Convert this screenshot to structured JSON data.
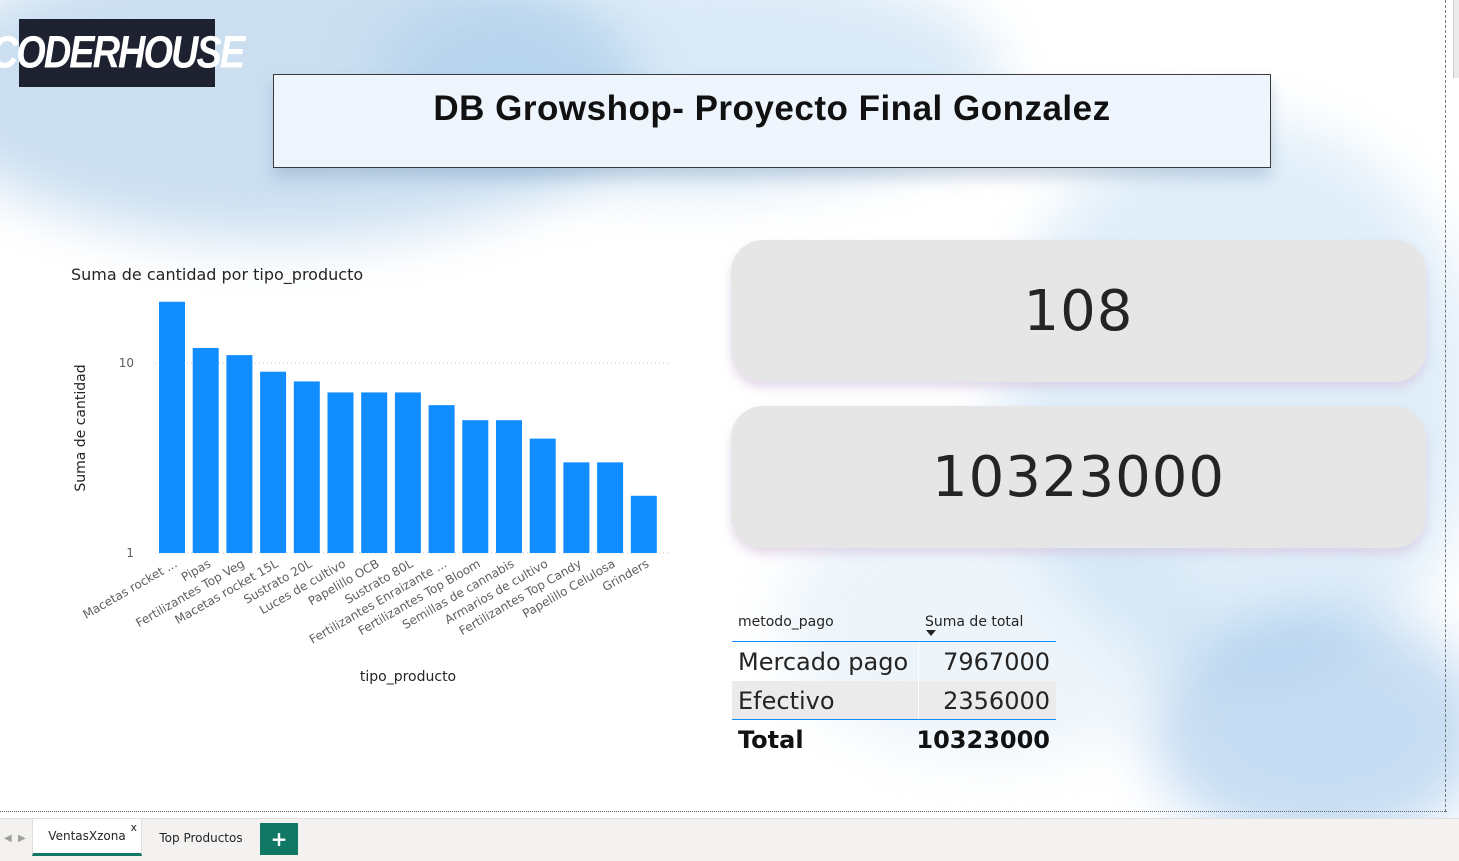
{
  "logo": {
    "text": "CODERHOUSE"
  },
  "header": {
    "title": "DB Growshop- Proyecto Final Gonzalez"
  },
  "kpis": [
    {
      "value": "108"
    },
    {
      "value": "10323000"
    }
  ],
  "table": {
    "columns": [
      "metodo_pago",
      "Suma de total"
    ],
    "rows": [
      {
        "metodo": "Mercado pago",
        "total": "7967000"
      },
      {
        "metodo": "Efectivo",
        "total": "2356000"
      }
    ],
    "total_label": "Total",
    "total_value": "10323000"
  },
  "tabs": {
    "active": "VentasXzona",
    "other": "Top Productos",
    "close_glyph": "x",
    "add_glyph": "+"
  },
  "colors": {
    "bar": "#118dff",
    "accent": "#117865",
    "logo_bg": "#1e2230",
    "card": "#e6e6e6"
  },
  "chart_data": {
    "type": "bar",
    "title": "Suma de cantidad por tipo_producto",
    "xlabel": "tipo_producto",
    "ylabel": "Suma de cantidad",
    "yscale": "log",
    "yticks": [
      1,
      10
    ],
    "ylim": [
      1,
      30
    ],
    "grid": true,
    "categories": [
      "Macetas rocket ...",
      "Pipas",
      "Fertilizantes Top Veg",
      "Macetas rocket 15L",
      "Sustrato 20L",
      "Luces de cultivo",
      "Papelillo OCB",
      "Sustrato 80L",
      "Fertilizantes Enraizante ...",
      "Fertilizantes Top Bloom",
      "Semillas de cannabis",
      "Armarios de cultivo",
      "Fertilizantes Top Candy",
      "Papelillo Celulosa",
      "Grinders"
    ],
    "values": [
      21,
      12,
      11,
      9,
      8,
      7,
      7,
      7,
      6,
      5,
      5,
      4,
      3,
      3,
      2
    ]
  }
}
